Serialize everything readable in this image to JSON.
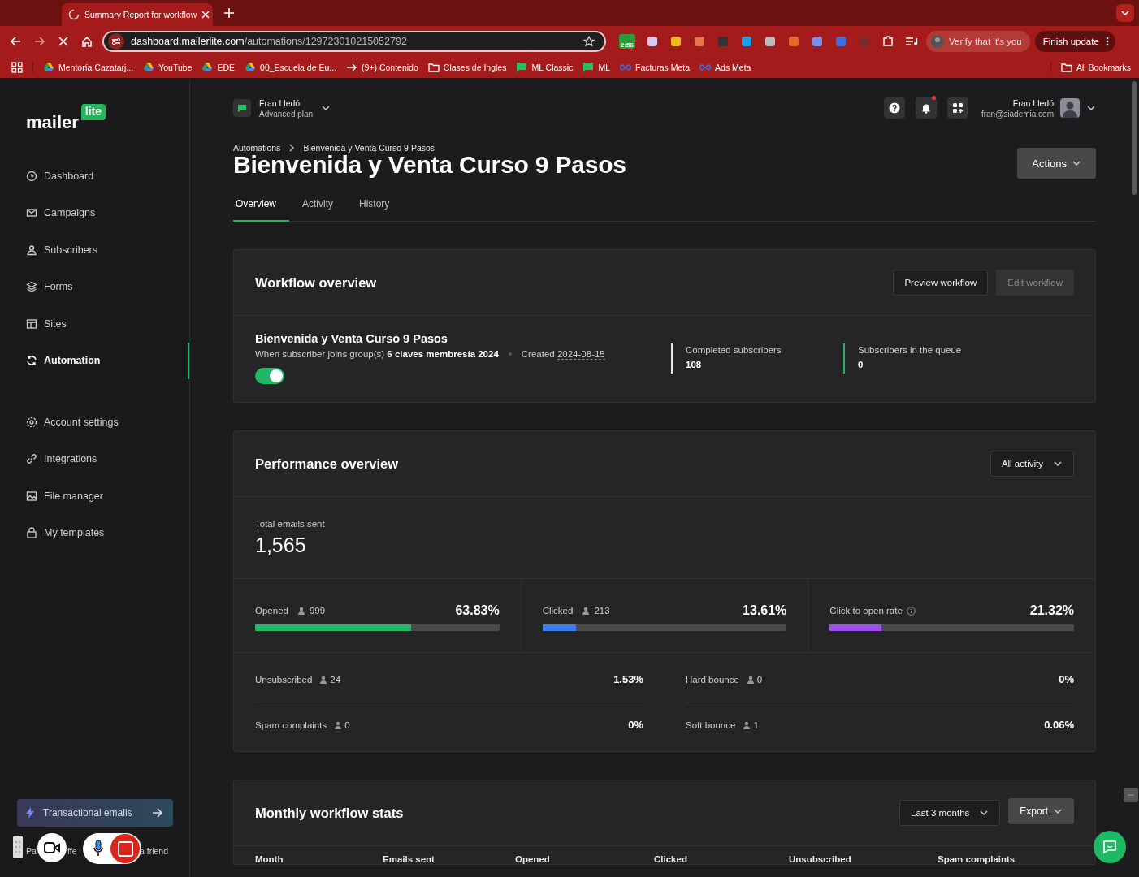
{
  "browser": {
    "tab": {
      "title": "Summary Report for workflow",
      "loading": true
    },
    "url": {
      "host": "dashboard.mailerlite.com",
      "path": "/automations/129723010215052792"
    },
    "extension_badge": "2:56",
    "profile_chip": "Verify that it's you",
    "update_button": "Finish update",
    "bookmarks": [
      {
        "label": "Mentoría Cazatarj...",
        "kind": "drive"
      },
      {
        "label": "YouTube",
        "kind": "drive"
      },
      {
        "label": "EDE",
        "kind": "drive"
      },
      {
        "label": "00_Escuela de Eu...",
        "kind": "drive"
      },
      {
        "label": "(9+) Contenido",
        "kind": "arrow"
      },
      {
        "label": "Clases de Ingles",
        "kind": "folder"
      },
      {
        "label": "ML Classic",
        "kind": "chat"
      },
      {
        "label": "ML",
        "kind": "chat"
      },
      {
        "label": "Facturas Meta",
        "kind": "meta"
      },
      {
        "label": "Ads Meta",
        "kind": "meta"
      }
    ],
    "all_bookmarks": "All Bookmarks"
  },
  "sidebar": {
    "logo": {
      "word": "mailer",
      "badge": "lite"
    },
    "items": [
      {
        "label": "Dashboard",
        "selected": false
      },
      {
        "label": "Campaigns",
        "selected": false
      },
      {
        "label": "Subscribers",
        "selected": false
      },
      {
        "label": "Forms",
        "selected": false
      },
      {
        "label": "Sites",
        "selected": false
      },
      {
        "label": "Automation",
        "selected": true
      }
    ],
    "settings_items": [
      {
        "label": "Account settings",
        "selected": false
      },
      {
        "label": "Integrations",
        "selected": false
      },
      {
        "label": "File manager",
        "selected": false
      },
      {
        "label": "My templates",
        "selected": false
      }
    ],
    "promo": "Transactional emails",
    "referral_fragments": [
      "Pa",
      "ffe",
      "a friend"
    ]
  },
  "topbar": {
    "account": {
      "name": "Fran Lledó",
      "plan": "Advanced plan"
    },
    "notifications_unread": true,
    "user": {
      "name": "Fran Lledó",
      "email": "fran@siademia.com"
    }
  },
  "breadcrumb": [
    "Automations",
    "Bienvenida y Venta Curso 9 Pasos"
  ],
  "title": "Bienvenida y Venta Curso 9 Pasos",
  "actions_button": "Actions",
  "tabs": [
    {
      "label": "Overview",
      "selected": true
    },
    {
      "label": "Activity",
      "selected": false
    },
    {
      "label": "History",
      "selected": false
    }
  ],
  "workflow_overview": {
    "heading": "Workflow overview",
    "buttons": [
      {
        "label": "Preview workflow",
        "disabled": false
      },
      {
        "label": "Edit workflow",
        "disabled": true
      }
    ],
    "name": "Bienvenida y Venta Curso 9 Pasos",
    "trigger": "When subscriber joins group(s) **6 claves membresía 2024**",
    "created_label": "Created",
    "created_date": "2024-08-15",
    "on": true,
    "stats": [
      {
        "label": "Completed subscribers",
        "value": "108",
        "color": "#e8e8e8"
      },
      {
        "label": "Subscribers in the queue",
        "value": "0",
        "color": "#22b35e"
      }
    ]
  },
  "performance": {
    "heading": "Performance overview",
    "filter": "All activity",
    "total_label": "Total emails sent",
    "total": "1,565",
    "rates": [
      {
        "label": "Opened",
        "count": "999",
        "percent": "63.83%",
        "level": 0.6383,
        "color": "#1fb865",
        "info": false
      },
      {
        "label": "Clicked",
        "count": "213",
        "percent": "13.61%",
        "level": 0.1361,
        "color": "#3a7ef0",
        "info": false
      },
      {
        "label": "Click to open rate",
        "percent": "21.32%",
        "level": 0.2132,
        "color": "#9d4ff0",
        "info": true
      }
    ],
    "other": [
      {
        "label": "Unsubscribed",
        "count": "24",
        "percent": "1.53%"
      },
      {
        "label": "Hard bounce",
        "count": "0",
        "percent": "0%"
      },
      {
        "label": "Spam complaints",
        "count": "0",
        "percent": "0%"
      },
      {
        "label": "Soft bounce",
        "count": "1",
        "percent": "0.06%"
      }
    ]
  },
  "monthly": {
    "heading": "Monthly workflow stats",
    "period": "Last 3 months",
    "export": "Export",
    "columns": [
      "Month",
      "Emails sent",
      "Opened",
      "Clicked",
      "Unsubscribed",
      "Spam complaints"
    ]
  }
}
